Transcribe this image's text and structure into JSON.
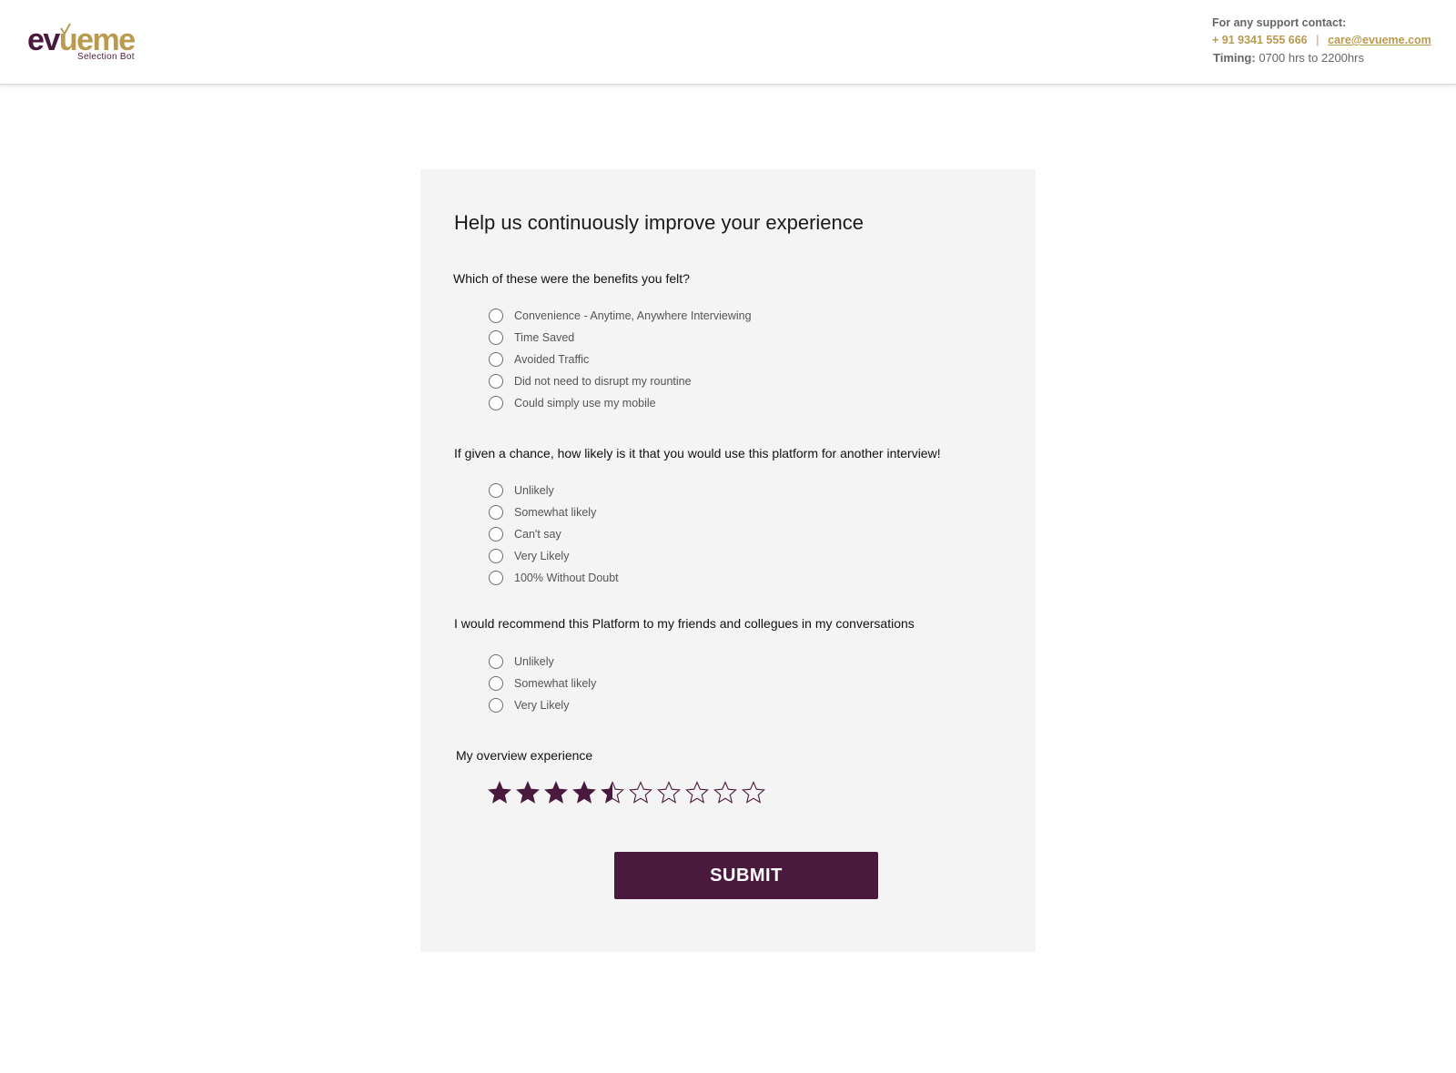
{
  "brand": {
    "logo_part1": "ev",
    "logo_part2": "ueme",
    "tagline": "Selection Bot",
    "color_primary": "#4a1a3e",
    "color_accent": "#b99a4f"
  },
  "support": {
    "title": "For any support contact:",
    "phone": "+ 91 9341 555 666",
    "separator": "|",
    "email": "care@evueme.com",
    "timing_label": "Timing:",
    "timing_value": "0700 hrs to  2200hrs"
  },
  "form": {
    "title": "Help us continuously improve your experience",
    "q1": {
      "question": "Which of these were the benefits you felt?",
      "options": [
        "Convenience - Anytime, Anywhere Interviewing",
        "Time Saved",
        "Avoided Traffic",
        "Did not need to disrupt my rountine",
        "Could simply use my mobile"
      ]
    },
    "q2": {
      "question": "If given a chance, how  likely is it that you would use this platform for another interview!",
      "options": [
        "Unlikely",
        "Somewhat likely",
        "Can't say",
        "Very Likely",
        "100% Without Doubt"
      ]
    },
    "q3": {
      "question": "I would recommend this Platform to my friends and collegues in my conversations",
      "options": [
        "Unlikely",
        "Somewhat likely",
        "Very Likely"
      ]
    },
    "q4": {
      "question": "My overview experience",
      "rating": 4.5,
      "max_rating": 10,
      "star_icon": "star-icon"
    },
    "submit_label": "SUBMIT"
  }
}
